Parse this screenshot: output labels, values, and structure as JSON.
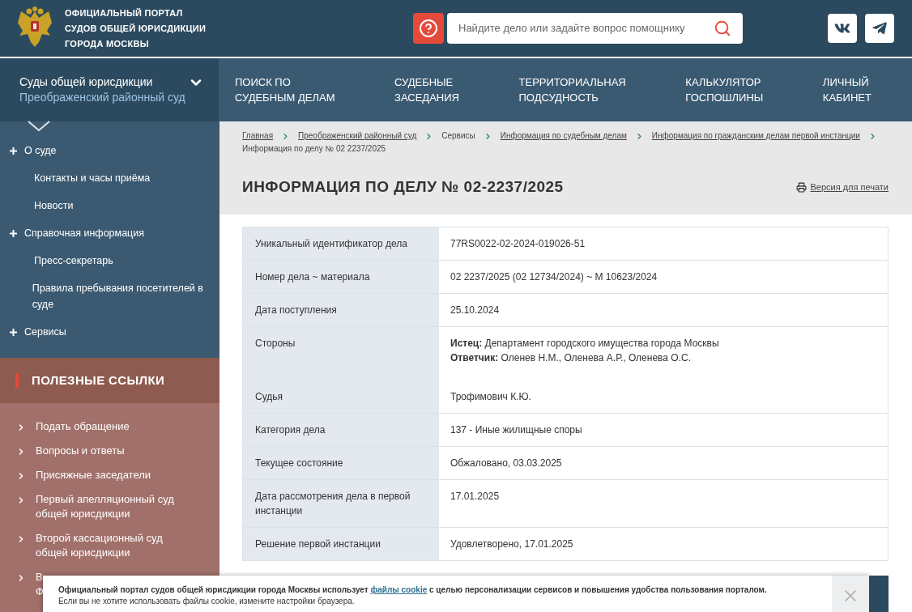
{
  "header": {
    "title_lines": [
      "ОФИЦИАЛЬНЫЙ ПОРТАЛ",
      "СУДОВ ОБЩЕЙ ЮРИСДИКЦИИ",
      "ГОРОДА МОСКВЫ"
    ],
    "search": {
      "placeholder": "Найдите дело или задайте вопрос помощнику"
    }
  },
  "court_selector": {
    "title": "Суды общей юрисдикции",
    "subtitle": "Преображенский районный суд"
  },
  "nav": [
    {
      "lines": [
        "ПОИСК ПО",
        "СУДЕБНЫМ ДЕЛАМ"
      ]
    },
    {
      "lines": [
        "СУДЕБНЫЕ",
        "ЗАСЕДАНИЯ"
      ]
    },
    {
      "lines": [
        "ТЕРРИТОРИАЛЬНАЯ",
        "ПОДСУДНОСТЬ"
      ]
    },
    {
      "lines": [
        "КАЛЬКУЛЯТОР",
        "ГОСПОШЛИНЫ"
      ]
    },
    {
      "lines": [
        "ЛИЧНЫЙ",
        "КАБИНЕТ"
      ]
    }
  ],
  "sidebar": {
    "items": [
      {
        "text": "О суде",
        "expandable": true
      },
      {
        "text": "Контакты и часы приёма",
        "expandable": false
      },
      {
        "text": "Новости",
        "expandable": false
      },
      {
        "text": "Справочная информация",
        "expandable": true
      },
      {
        "text": "Пресс-секретарь",
        "expandable": false
      },
      {
        "text": "Правила пребывания посетителей в суде",
        "expandable": false
      },
      {
        "text": "Сервисы",
        "expandable": true
      }
    ]
  },
  "useful_links": {
    "title": "ПОЛЕЗНЫЕ ССЫЛКИ",
    "items": [
      {
        "lines": [
          "Подать обращение"
        ]
      },
      {
        "lines": [
          "Вопросы и ответы"
        ]
      },
      {
        "lines": [
          "Присяжные заседатели"
        ]
      },
      {
        "lines": [
          "Первый апелляционный суд",
          "общей юрисдикции"
        ]
      },
      {
        "lines": [
          "Второй кассационный суд",
          "общей юрисдикции"
        ]
      },
      {
        "lines": [
          "В",
          "Ф"
        ]
      }
    ]
  },
  "breadcrumbs": [
    {
      "text": "Главная",
      "kind": "link"
    },
    {
      "text": "Преображенский районный суд",
      "kind": "link"
    },
    {
      "text": "Сервисы",
      "kind": "text"
    },
    {
      "text": "Информация по судебным делам",
      "kind": "link"
    },
    {
      "text": "Информация по гражданским делам первой инстанции",
      "kind": "link"
    },
    {
      "text": "Информация по делу № 02 2237/2025",
      "kind": "text"
    }
  ],
  "page_title": "ИНФОРМАЦИЯ ПО ДЕЛУ № 02-2237/2025",
  "print_link": "Версия для печати",
  "table": {
    "rows": [
      {
        "kind": "plain",
        "label": "Уникальный идентификатор дела",
        "value": "77RS0022-02-2024-019026-51"
      },
      {
        "kind": "plain",
        "label": "Номер дела ~ материала",
        "value": "02 2237/2025 (02 12734/2024) ~  М 10623/2024"
      },
      {
        "kind": "plain",
        "label": "Дата поступления",
        "value": "25.10.2024"
      },
      {
        "kind": "parties",
        "label": "Стороны",
        "lines": [
          "**Истец:** Департамент городского имущества города Москвы",
          "**Ответчик:** Оленев Н.М., Оленева А.Р., Оленева О.С."
        ]
      },
      {
        "kind": "plain",
        "label": "Судья",
        "value": "Трофимович К.Ю."
      },
      {
        "kind": "plain",
        "label": "Категория дела",
        "value": "137 - Иные жилищные споры"
      },
      {
        "kind": "plain",
        "label": "Текущее состояние",
        "value": "Обжаловано, 03.03.2025"
      },
      {
        "kind": "plain",
        "label": "Дата рассмотрения дела в первой инстанции",
        "value": "17.01.2025"
      },
      {
        "kind": "plain",
        "label": "Решение первой инстанции",
        "value": "Удовлетворено, 17.01.2025"
      }
    ]
  },
  "cookie_banner": {
    "before": "Официальный портал судов общей юрисдикции города Москвы использует ",
    "link": "файлы cookie",
    "after": " с целью персонализации сервисов и повышения удобства пользования порталом.",
    "note": "Если вы не хотите использовать файлы cookie, измените настройки браузера."
  }
}
